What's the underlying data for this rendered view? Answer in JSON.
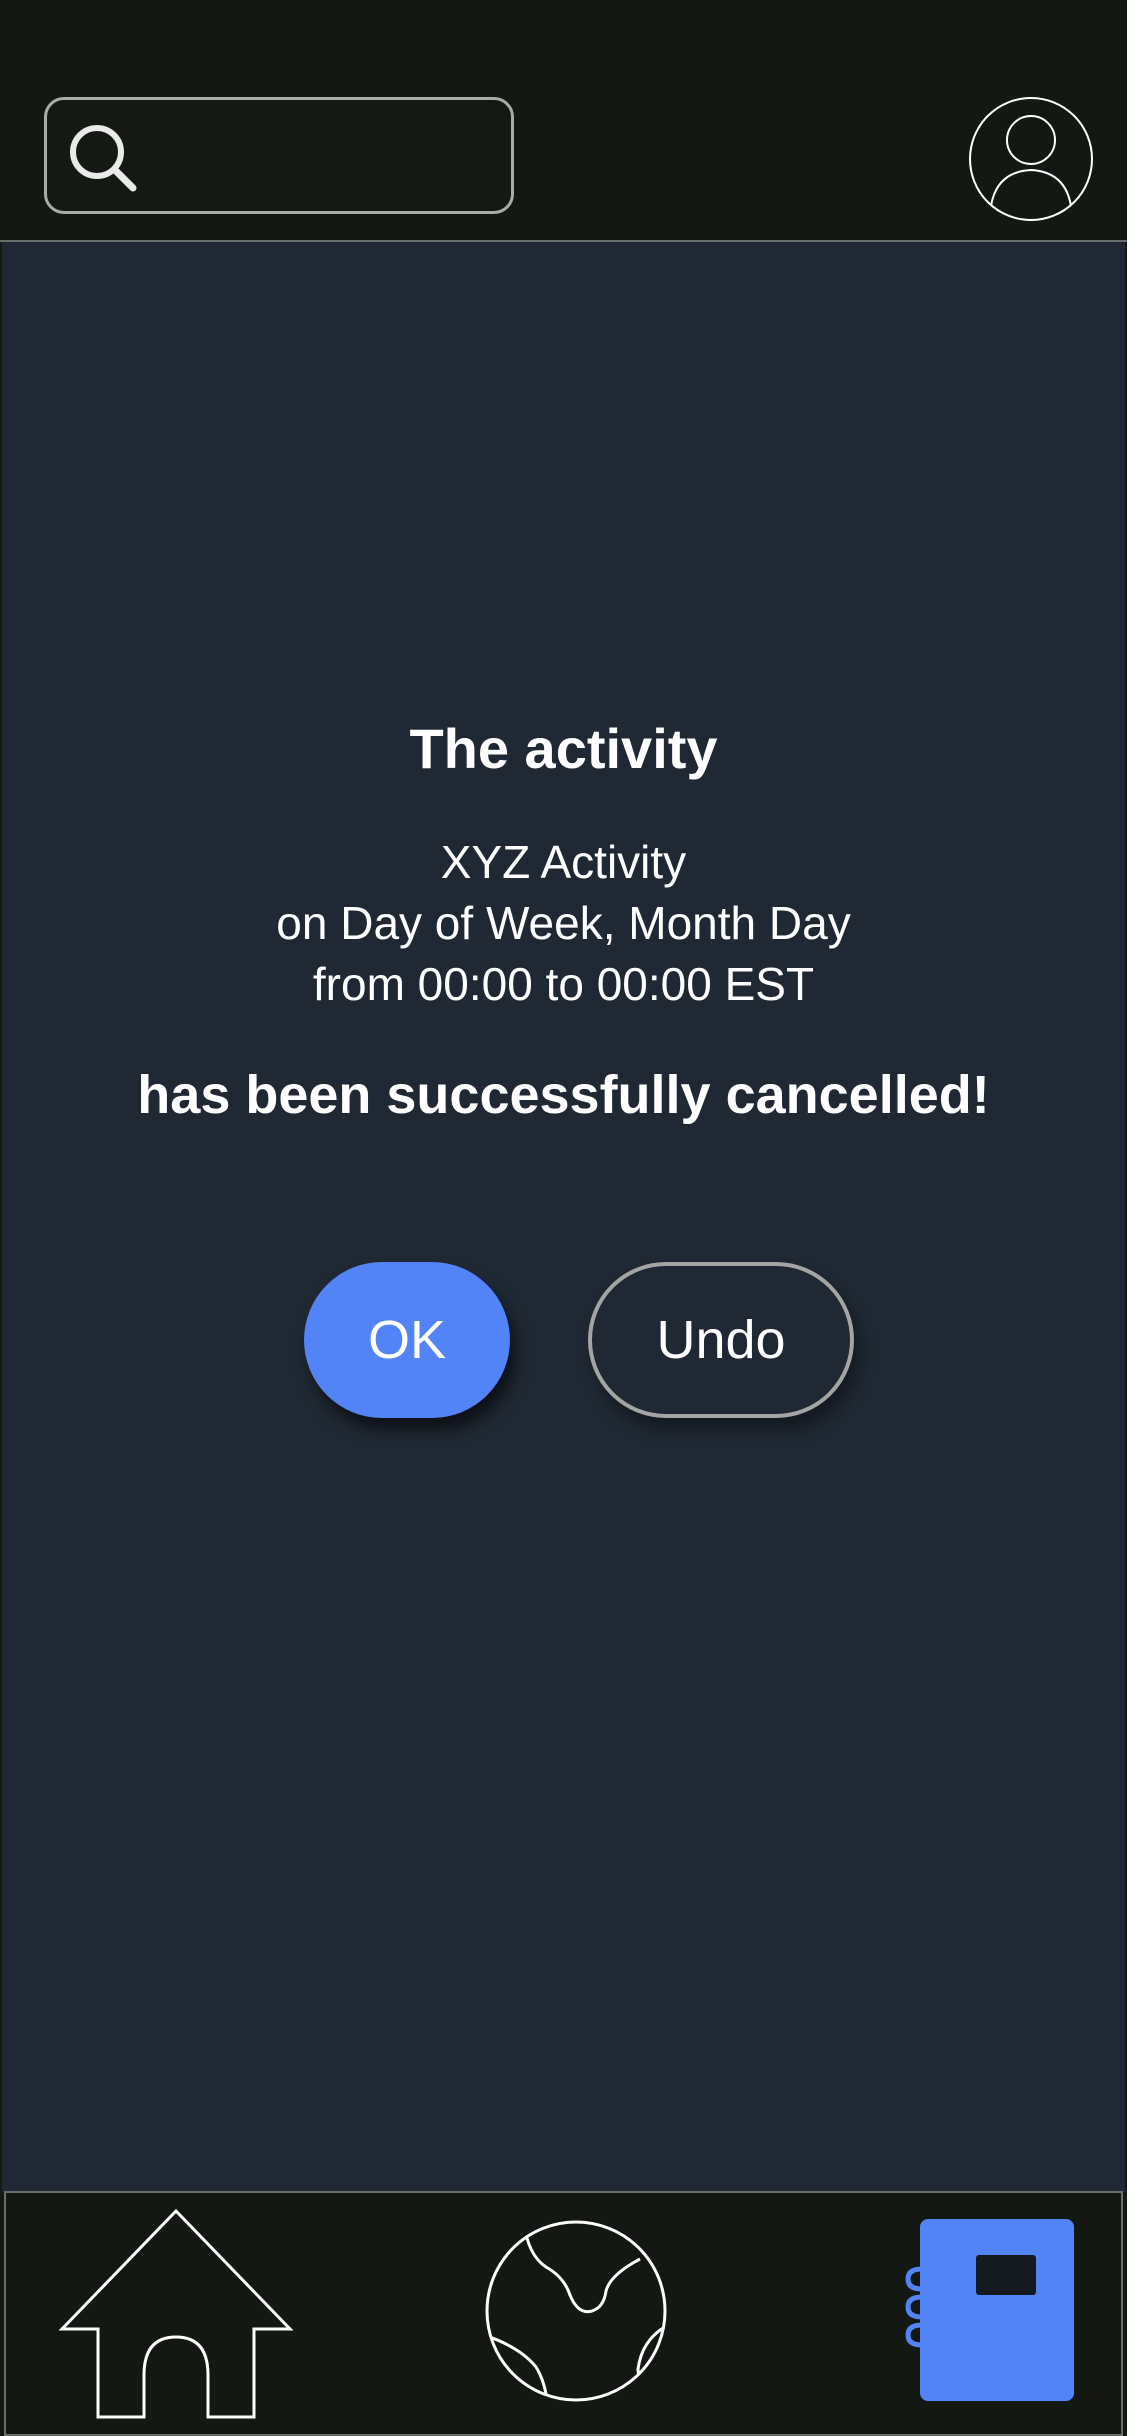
{
  "header": {
    "search": {
      "placeholder": "",
      "value": "",
      "icon": "search-icon"
    },
    "profile": {
      "icon": "profile-icon"
    }
  },
  "confirmation": {
    "title": "The activity",
    "activity_name": "XYZ Activity",
    "date_line": "on Day of Week, Month Day",
    "time_line": "from 00:00 to 00:00 EST",
    "status": "has been successfully cancelled!"
  },
  "actions": {
    "ok_label": "OK",
    "undo_label": "Undo"
  },
  "bottom_nav": {
    "items": [
      {
        "icon": "home-icon",
        "active": false
      },
      {
        "icon": "globe-icon",
        "active": false
      },
      {
        "icon": "notebook-icon",
        "active": true
      }
    ]
  },
  "colors": {
    "accent": "#5284f7",
    "background": "#1f2833",
    "bars": "#131812"
  }
}
